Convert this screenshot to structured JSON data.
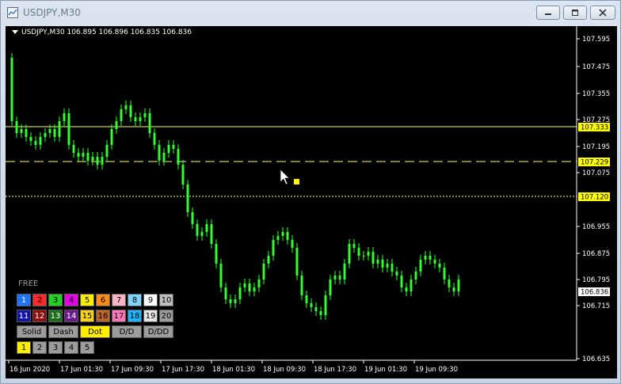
{
  "window": {
    "title": "USDJPY,M30"
  },
  "chart": {
    "header": "USDJPY,M30  106.895 106.896 106.835 106.836",
    "price_labels": [
      "107.595",
      "107.475",
      "107.355",
      "107.275",
      "107.195",
      "107.075",
      "106.955",
      "106.875",
      "106.795",
      "106.715",
      "106.635"
    ],
    "line_labels": [
      {
        "text": "107.333",
        "style": "solid"
      },
      {
        "text": "107.229",
        "style": "dash"
      },
      {
        "text": "107.120",
        "style": "dot"
      }
    ],
    "current_price": "106.836",
    "time_labels": [
      "16 Jun 2020",
      "17 Jun 01:30",
      "17 Jun 09:30",
      "17 Jun 17:30",
      "18 Jun 01:30",
      "18 Jun 09:30",
      "18 Jun 17:30",
      "19 Jun 01:30",
      "19 Jun 09:30"
    ],
    "colors": {
      "candle": "#33ff33",
      "line": "#ffff66",
      "label_bg": "#ffff00"
    }
  },
  "panel": {
    "title": "FREE",
    "colors": [
      {
        "label": "1",
        "bg": "#1e73ff",
        "fg": "#fff"
      },
      {
        "label": "2",
        "bg": "#ff2a2a",
        "fg": "#000"
      },
      {
        "label": "3",
        "bg": "#21d021",
        "fg": "#000"
      },
      {
        "label": "4",
        "bg": "#e300e3",
        "fg": "#000"
      },
      {
        "label": "5",
        "bg": "#ffee00",
        "fg": "#000"
      },
      {
        "label": "6",
        "bg": "#ff8c1a",
        "fg": "#000"
      },
      {
        "label": "7",
        "bg": "#ffb3c6",
        "fg": "#000"
      },
      {
        "label": "8",
        "bg": "#7fd4ff",
        "fg": "#000"
      },
      {
        "label": "9",
        "bg": "#ffffff",
        "fg": "#000"
      },
      {
        "label": "10",
        "bg": "#bfbfbf",
        "fg": "#000"
      },
      {
        "label": "11",
        "bg": "#1414a8",
        "fg": "#fff"
      },
      {
        "label": "12",
        "bg": "#8b0d0d",
        "fg": "#fff"
      },
      {
        "label": "13",
        "bg": "#1c6e1c",
        "fg": "#fff"
      },
      {
        "label": "14",
        "bg": "#6a1a8a",
        "fg": "#fff"
      },
      {
        "label": "15",
        "bg": "#ffd21a",
        "fg": "#000"
      },
      {
        "label": "16",
        "bg": "#b8662a",
        "fg": "#000"
      },
      {
        "label": "17",
        "bg": "#ff78b8",
        "fg": "#000"
      },
      {
        "label": "18",
        "bg": "#1eb4ff",
        "fg": "#000"
      },
      {
        "label": "19",
        "bg": "#e6e6e6",
        "fg": "#000"
      },
      {
        "label": "20",
        "bg": "#9c9c9c",
        "fg": "#000"
      }
    ],
    "styles": [
      {
        "label": "Solid",
        "active": false
      },
      {
        "label": "Dash",
        "active": false
      },
      {
        "label": "Dot",
        "active": true
      },
      {
        "label": "D/D",
        "active": false
      },
      {
        "label": "D/DD",
        "active": false
      }
    ],
    "widths": [
      {
        "label": "1",
        "active": true
      },
      {
        "label": "2",
        "active": false
      },
      {
        "label": "3",
        "active": false
      },
      {
        "label": "4",
        "active": false
      },
      {
        "label": "5",
        "active": false
      }
    ]
  }
}
